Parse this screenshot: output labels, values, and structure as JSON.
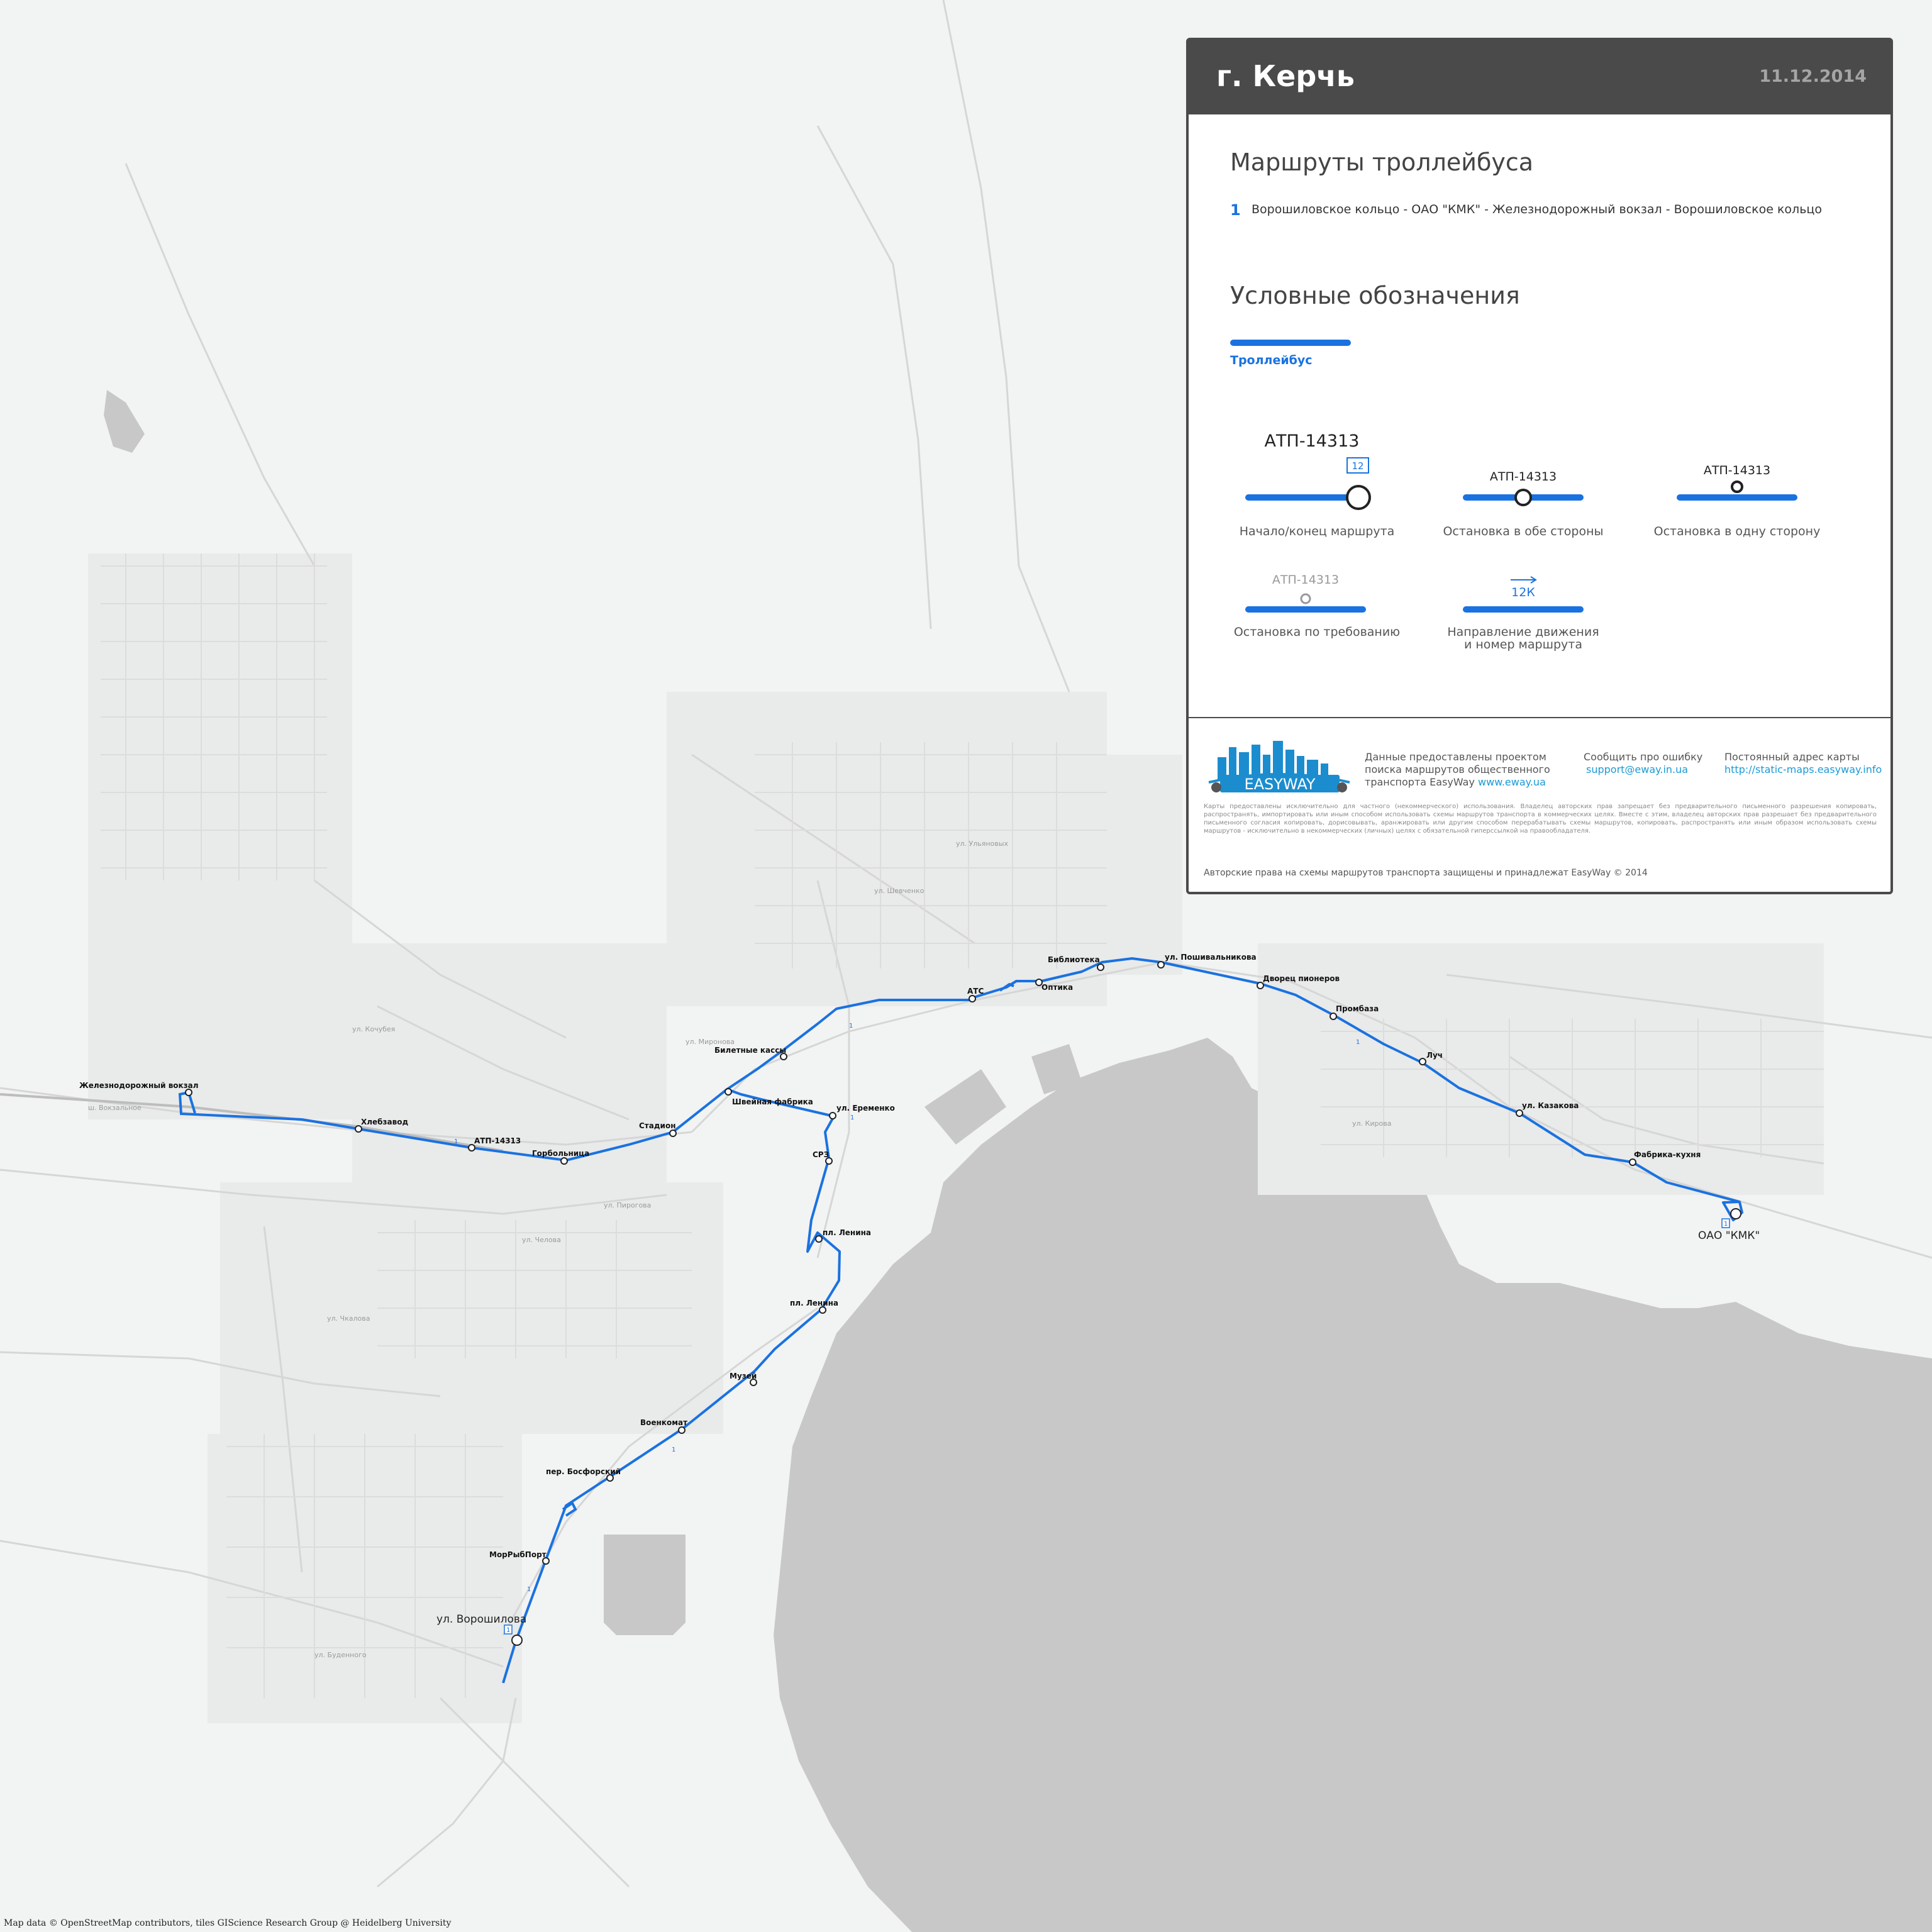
{
  "panel": {
    "city": "г. Керчь",
    "date": "11.12.2014",
    "routes_title": "Маршруты троллейбуса",
    "routes": [
      {
        "number": "1",
        "name": "Ворошиловское кольцо - ОАО \"КМК\" - Железнодорожный вокзал - Ворошиловское кольцо"
      }
    ],
    "legend_title": "Условные обозначения",
    "legend_line_label": "Троллейбус",
    "legend_items": {
      "terminal": {
        "stop": "АТП-14313",
        "route_box": "12",
        "caption": "Начало/конец маршрута"
      },
      "both_ways": {
        "stop": "АТП-14313",
        "caption": "Остановка в обе стороны"
      },
      "one_way": {
        "stop": "АТП-14313",
        "caption": "Остановка в одну сторону"
      },
      "on_request": {
        "stop": "АТП-14313",
        "caption": "Остановка по требованию"
      },
      "direction": {
        "route": "12К",
        "caption_line1": "Направление движения",
        "caption_line2": "и номер маршрута"
      }
    },
    "footer": {
      "logo_text": "EASYWAY",
      "provided_line1": "Данные предоставлены проектом",
      "provided_line2": "поиска маршрутов общественного",
      "provided_line3": "транспорта EasyWay",
      "provided_link": "www.eway.ua",
      "report_title": "Сообщить про ошибку",
      "report_link": "support@eway.in.ua",
      "address_title": "Постоянный адрес карты",
      "address_link": "http://static-maps.easyway.info",
      "disclaimer": "Карты предоставлены исключительно для частного (некоммерческого) использования. Владелец авторских прав запрещает без предварительного письменного разрешения копировать, распространять, импортировать или иным способом использовать схемы маршрутов транспорта в коммерческих целях. Вместе с этим, владелец авторских прав разрешает без предварительного письменного согласия копировать, дорисовывать, аранжировать или другим способом перерабатывать схемы маршрутов, копировать, распространять или иным образом использовать схемы маршрутов - исключительно в некоммерческих (личных) целях с обязательной гиперссылкой на правообладателя.",
      "copyright": "Авторские права на схемы маршрутов транспорта защищены и принадлежат EasyWay © 2014"
    }
  },
  "map": {
    "attribution": "Map data © OpenStreetMap contributors, tiles GIScience Research Group @ Heidelberg University",
    "route_color": "#1a72e0",
    "route_number": "1",
    "terminal_box": "1",
    "stops": {
      "zhd_vokzal": "Железнодорожный вокзал",
      "hlebozavod": "Хлебзавод",
      "atp": "АТП-14313",
      "gorbolnitsa": "Горбольница",
      "stadion": "Стадион",
      "biletnye_kassy": "Билетные кассы",
      "shveinaya": "Швейная фабрика",
      "eremenko": "ул. Еременко",
      "srz": "СРЗ",
      "pl_lenina_1": "пл. Ленина",
      "pl_lenina_2": "пл. Ленина",
      "muzei": "Музей",
      "voenkomat": "Военкомат",
      "bosforsky": "пер. Босфорский",
      "morrybport": "МорРыбПорт",
      "voroshilova": "ул. Ворошилова",
      "ats": "АТС",
      "optika": "Оптика",
      "biblioteka": "Библиотека",
      "poshivalnikova": "ул. Пошивальникова",
      "dvorets": "Дворец пионеров",
      "prombaza": "Промбаза",
      "luch": "Луч",
      "kazakova": "ул. Казакова",
      "fabrika_kuhnya": "Фабрика-кухня",
      "kmk": "ОАО \"КМК\""
    },
    "streets": {
      "vokzalnoe": "ш. Вокзальное",
      "chelov": "ул. Челова",
      "pirogova": "ул. Пирогова",
      "chkalova": "ул. Чкалова",
      "kirova": "ул. Кирова",
      "ulitskogo": "ул. Ульяновых",
      "shevchenko": "ул. Шевченко",
      "mironova": "ул. Мироновa",
      "budennogo": "ул. Буденного",
      "kasatkina": "ул. Кочубея"
    }
  }
}
